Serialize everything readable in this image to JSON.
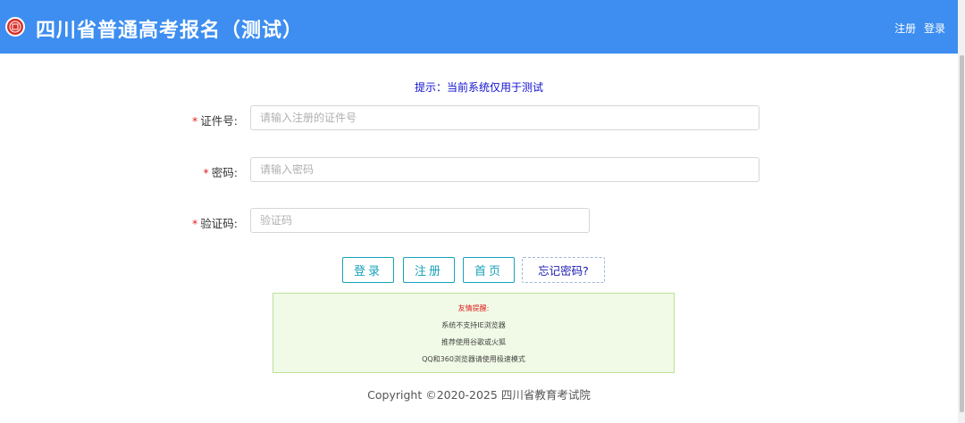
{
  "header": {
    "title": "四川省普通高考报名（测试）",
    "register_link": "注册",
    "login_link": "登录"
  },
  "hint": "提示：当前系统仅用于测试",
  "form": {
    "id_label": "证件号:",
    "id_placeholder": "请输入注册的证件号",
    "password_label": "密码:",
    "password_placeholder": "请输入密码",
    "captcha_label": "验证码:",
    "captcha_placeholder": "验证码",
    "required_mark": "*"
  },
  "buttons": {
    "login": "登录",
    "register": "注册",
    "home": "首页",
    "forgot": "忘记密码?"
  },
  "notice": {
    "title": "友情提醒:",
    "line1": "系统不支持IE浏览器",
    "line2": "推荐使用谷歌或火狐",
    "line3": "QQ和360浏览器请使用极速模式"
  },
  "footer": {
    "copyright": "Copyright ©2020-2025 四川省教育考试院"
  },
  "colors": {
    "header_bg": "#3d8ef0",
    "accent_teal": "#17a2b8",
    "required_red": "#e02020",
    "notice_bg": "#f1fae6"
  }
}
